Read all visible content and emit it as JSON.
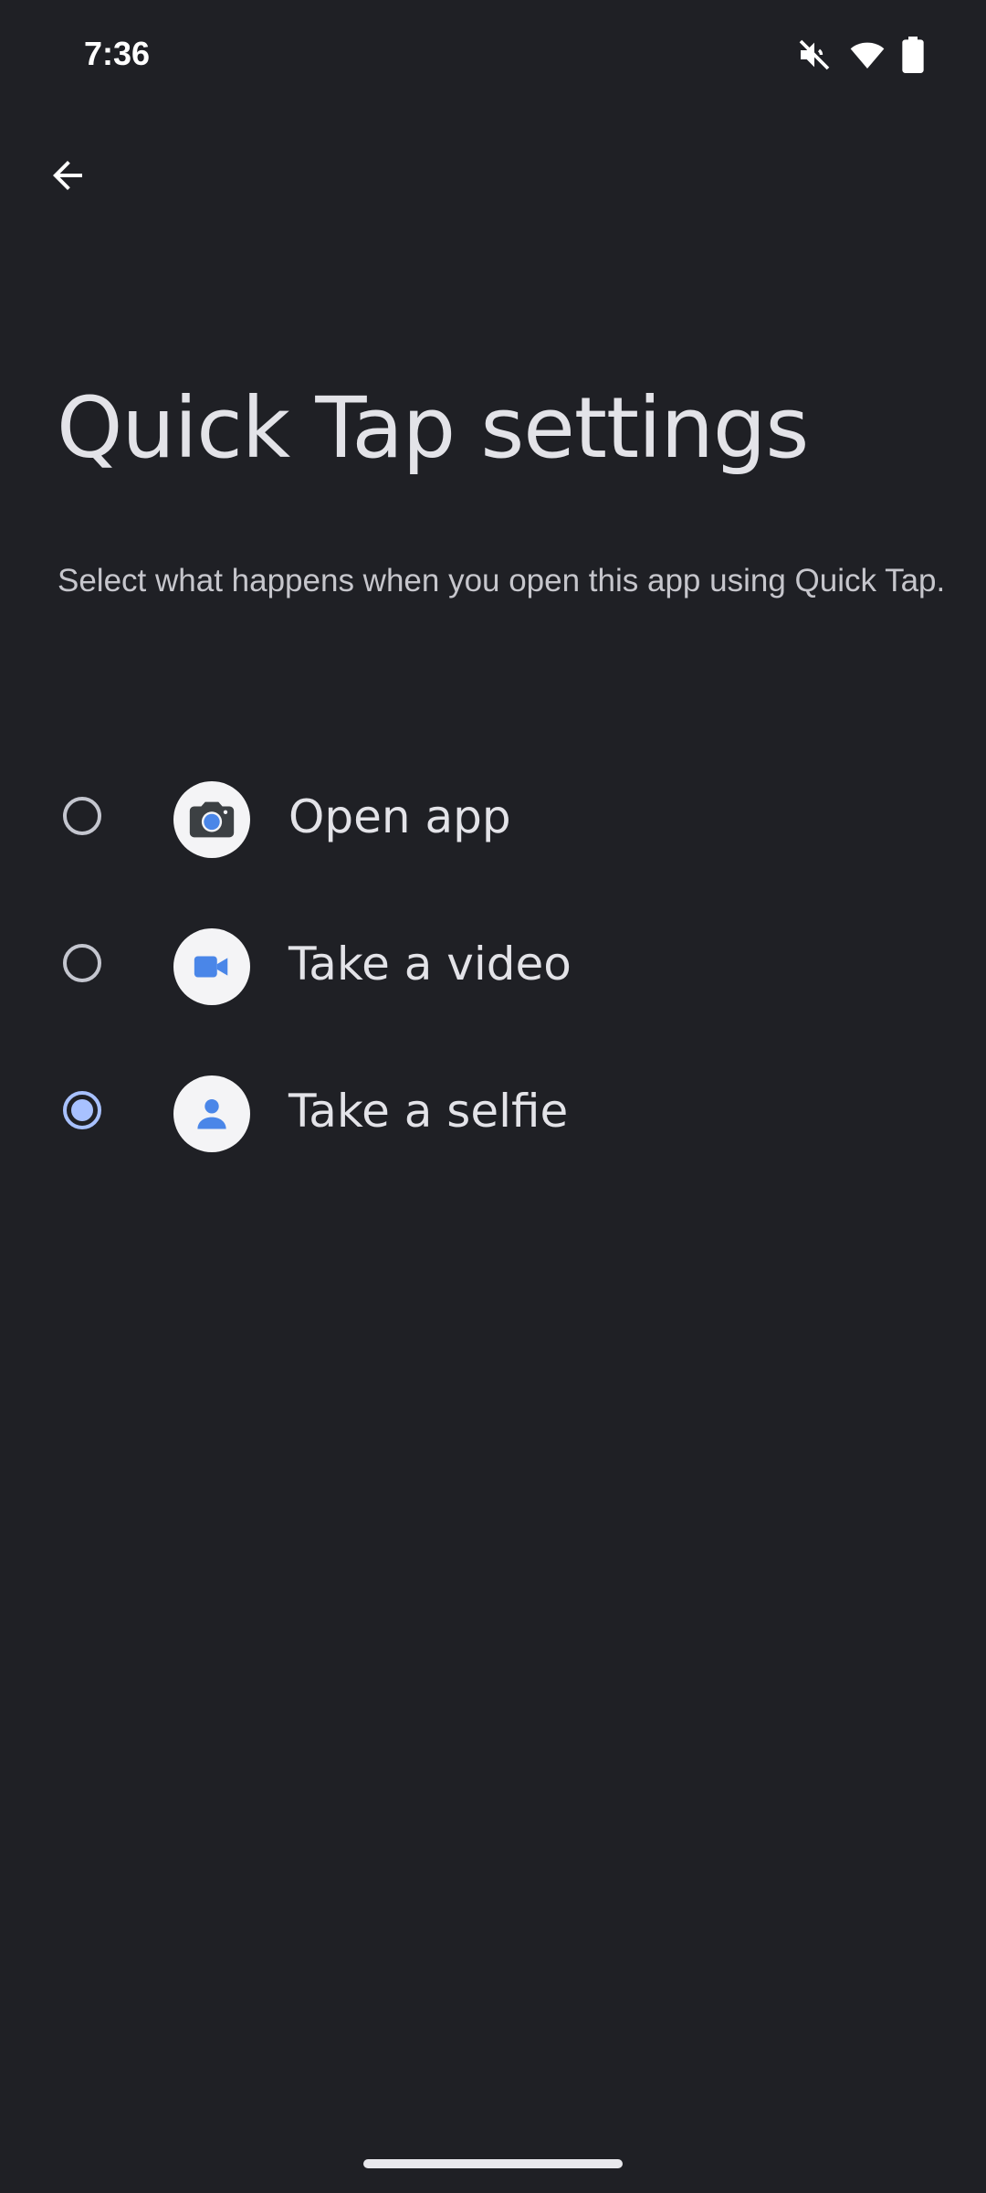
{
  "status_bar": {
    "time": "7:36",
    "icons": [
      "mute-icon",
      "wifi-icon",
      "battery-icon"
    ]
  },
  "header": {
    "back_icon": "arrow-left-icon",
    "title": "Quick Tap settings",
    "subtitle": "Select what happens when you open this app using Quick Tap."
  },
  "options": [
    {
      "label": "Open app",
      "icon": "camera-icon",
      "selected": false
    },
    {
      "label": "Take a video",
      "icon": "video-icon",
      "selected": false
    },
    {
      "label": "Take a selfie",
      "icon": "person-icon",
      "selected": true
    }
  ],
  "colors": {
    "background": "#1f2025",
    "accent": "#a8c1ff",
    "icon_blue": "#4a86e8"
  }
}
